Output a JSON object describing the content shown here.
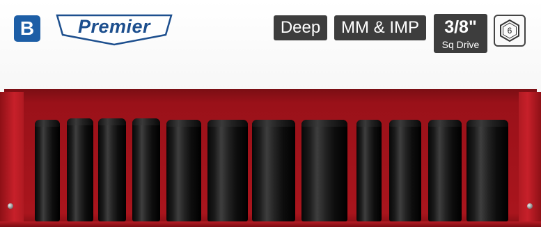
{
  "badge": {
    "letter": "B"
  },
  "logo": {
    "brand": "Premier"
  },
  "tags": {
    "type": "Deep",
    "standards": "MM & IMP",
    "drive_size": "3/8\"",
    "drive_label": "Sq Drive",
    "points": "6"
  },
  "colors": {
    "brand_blue": "#1d5ea6",
    "tag_dark": "#3d3d3d",
    "tray_red": "#a9151d"
  },
  "icons": [
    "hexagon-6-point-icon"
  ],
  "sockets": [
    {
      "id": "s1"
    },
    {
      "id": "s2"
    },
    {
      "id": "s3"
    },
    {
      "id": "s4"
    },
    {
      "id": "s5"
    },
    {
      "id": "s6"
    },
    {
      "id": "s7"
    },
    {
      "id": "s8"
    },
    {
      "id": "s9"
    },
    {
      "id": "s10"
    },
    {
      "id": "s11"
    },
    {
      "id": "s12"
    }
  ]
}
